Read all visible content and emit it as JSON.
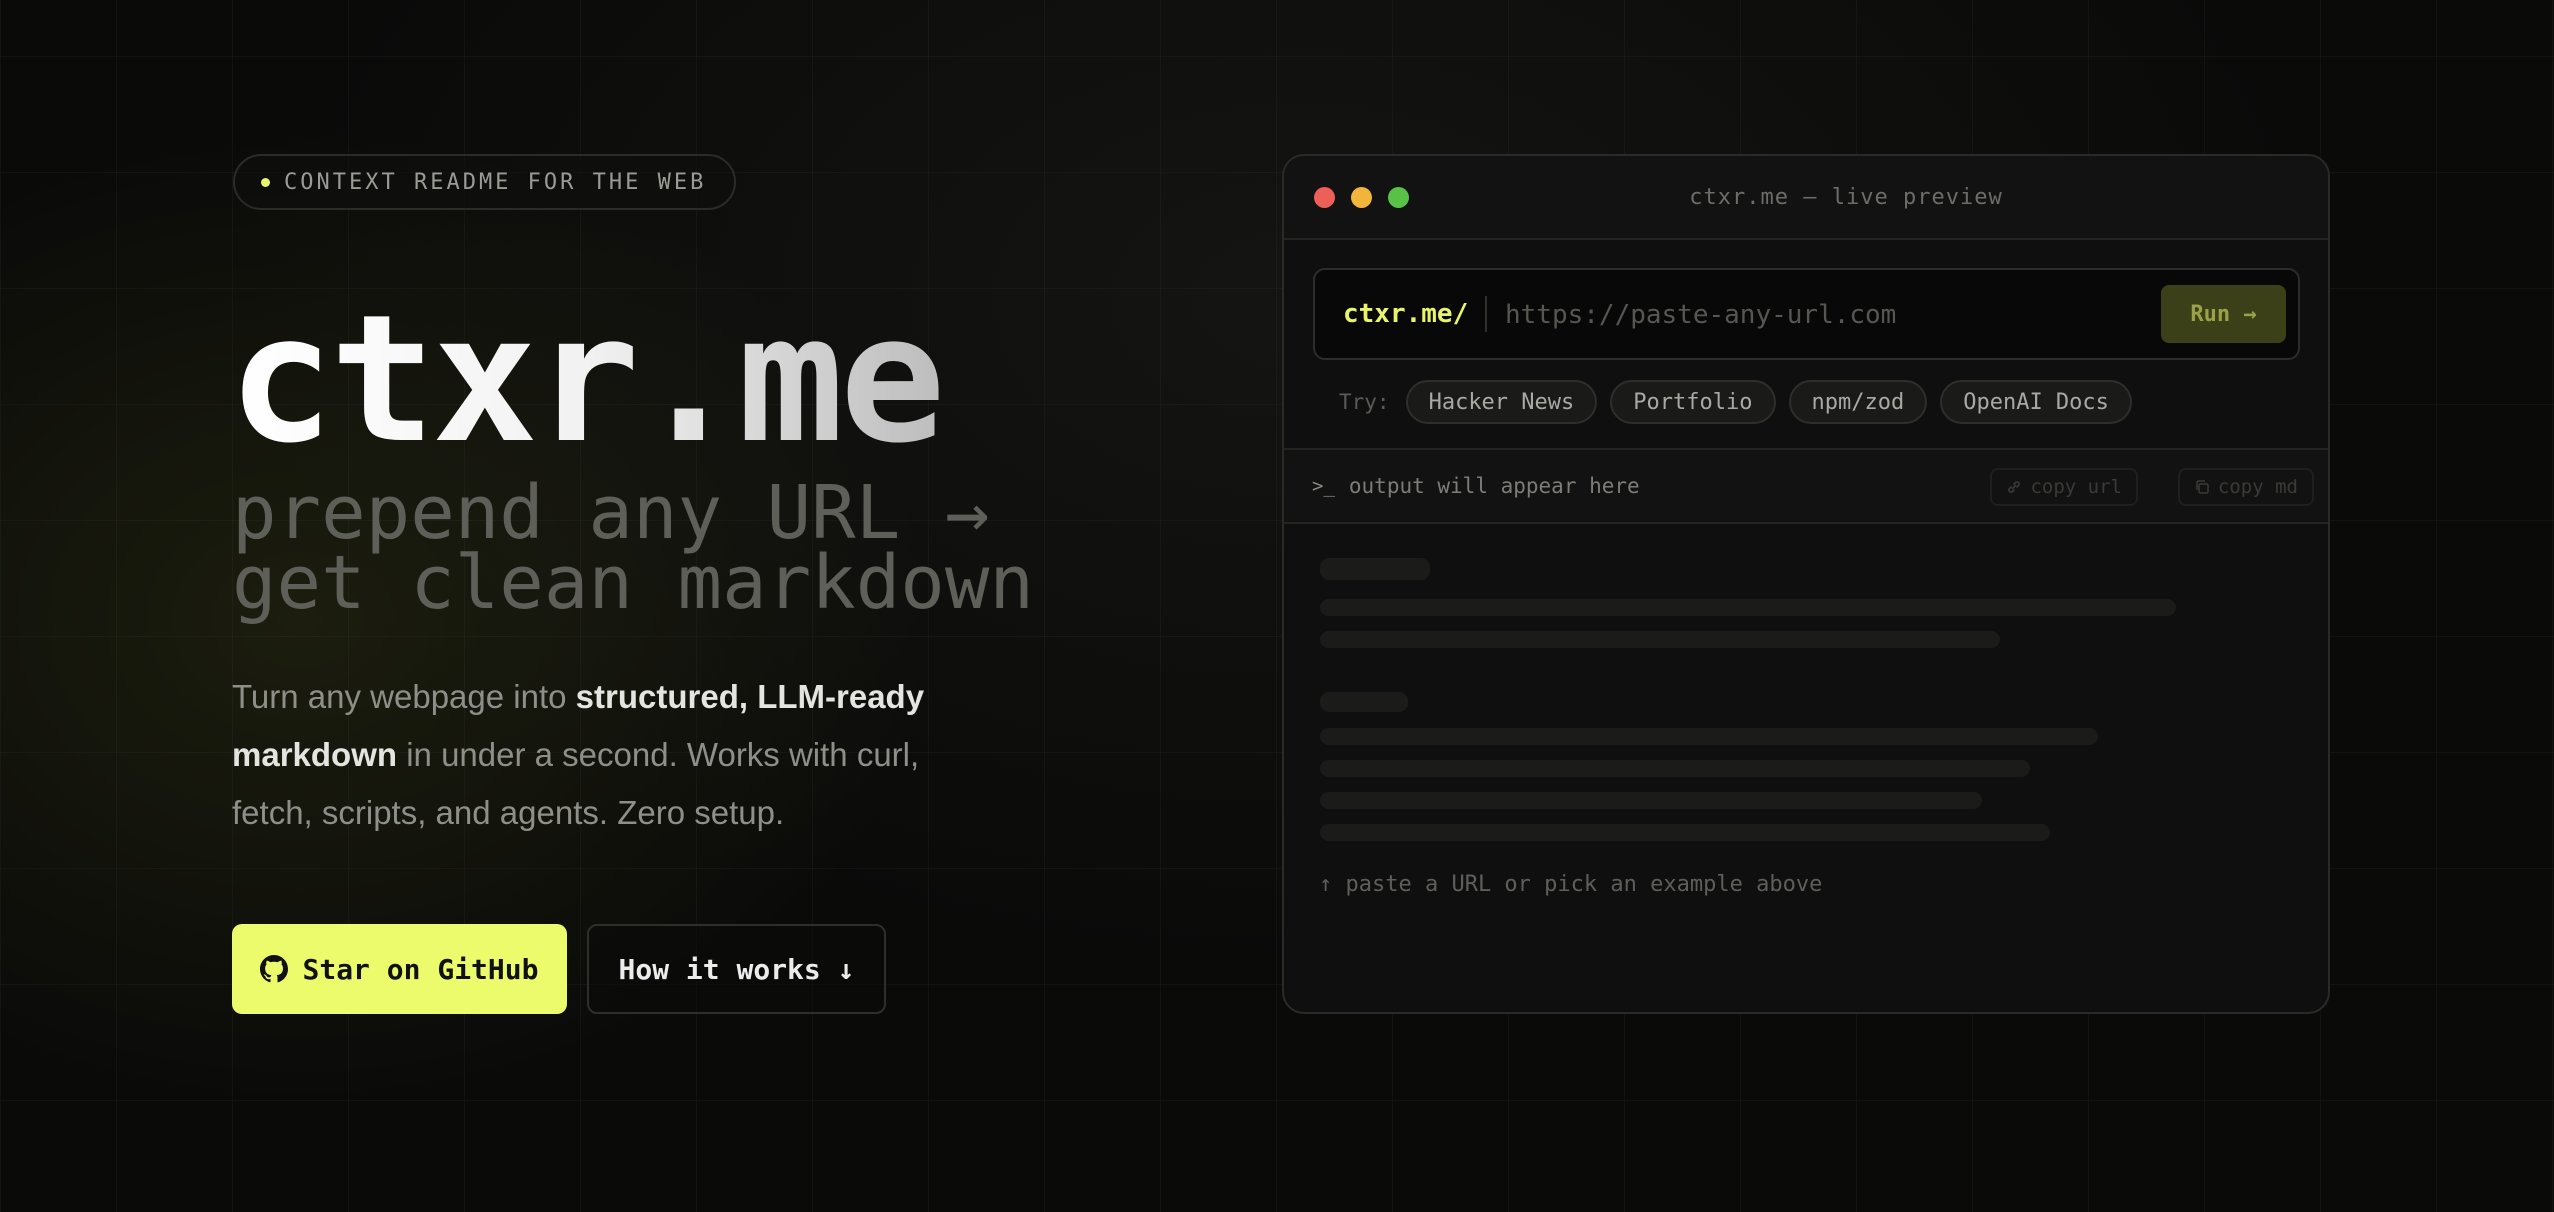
{
  "hero": {
    "badge": "CONTEXT README FOR THE WEB",
    "title": "ctxr.me",
    "subtitle_line1": "prepend any URL →",
    "subtitle_line2": "get clean markdown",
    "description": {
      "part1": "Turn any webpage into ",
      "bold": "structured, LLM-ready markdown",
      "part2": " in under a second. Works with curl, fetch, scripts, and agents. Zero setup."
    },
    "primary_button": "Star on GitHub",
    "secondary_button": "How it works ↓"
  },
  "preview": {
    "window_title": "ctxr.me — live preview",
    "prefix": "ctxr.me/",
    "url_placeholder": "https://paste-any-url.com",
    "url_value": "",
    "run_label": "Run →",
    "try_label": "Try:",
    "examples": [
      "Hacker News",
      "Portfolio",
      "npm/zod",
      "OpenAI Docs"
    ],
    "output_placeholder": "output will appear here",
    "copy_url_label": "copy url",
    "copy_md_label": "copy md",
    "hint": "↑ paste a URL or pick an example above"
  },
  "colors": {
    "accent": "#ecfb6c",
    "background": "#0a0a09",
    "window_bg": "#0f0f0f",
    "dot_red": "#ed5f57",
    "dot_yellow": "#f2b53c",
    "dot_green": "#58c246"
  },
  "icons": {
    "badge_dot": "dot-icon",
    "github": "github-icon",
    "prompt": "terminal-prompt-icon",
    "copy_url": "link-icon",
    "copy_md": "copy-icon"
  }
}
